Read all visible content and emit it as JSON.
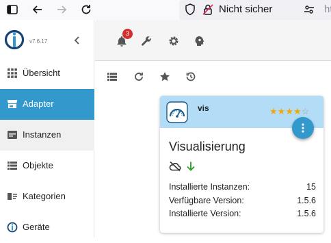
{
  "browser": {
    "security_label": "Nicht sicher",
    "url_prefix": "http:/"
  },
  "sidebar": {
    "version": "v7.6.17",
    "items": [
      {
        "label": "Übersicht",
        "icon": "grid-icon"
      },
      {
        "label": "Adapter",
        "icon": "store-icon"
      },
      {
        "label": "Instanzen",
        "icon": "instances-icon"
      },
      {
        "label": "Objekte",
        "icon": "list-icon"
      },
      {
        "label": "Kategorien",
        "icon": "categories-icon"
      },
      {
        "label": "Geräte",
        "icon": "devices-icon"
      }
    ],
    "active_index": 1
  },
  "toolbar": {
    "notification_count": "3"
  },
  "adapter_card": {
    "name": "vis",
    "title": "Visualisierung",
    "rating": 4,
    "rating_max": 5,
    "info": [
      {
        "label": "Installierte Instanzen:",
        "value": "15"
      },
      {
        "label": "Verfügbare Version:",
        "value": "1.5.6"
      },
      {
        "label": "Installierte Version:",
        "value": "1.5.6"
      }
    ]
  },
  "colors": {
    "accent": "#3399cc",
    "card_header": "#b3dcf6",
    "badge": "#d32f2f",
    "star": "#f5a700",
    "ok_arrow": "#2e9e2e"
  }
}
